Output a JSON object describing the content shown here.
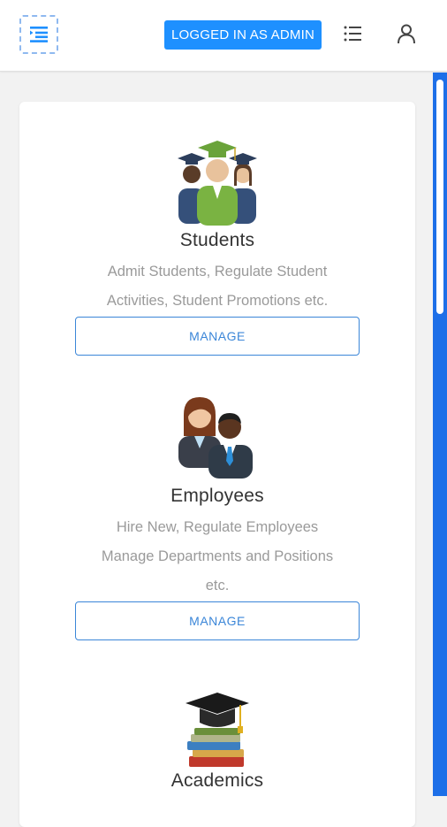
{
  "header": {
    "menu_icon": "sidebar-toggle-icon",
    "admin_badge": "LOGGED IN AS ADMIN",
    "list_icon": "list-icon",
    "user_icon": "user-icon"
  },
  "modules": [
    {
      "title": "Students",
      "description_lines": [
        "Admit Students, Regulate Student",
        "Activities, Student Promotions etc."
      ],
      "button": "MANAGE",
      "icon": "graduates-icon"
    },
    {
      "title": "Employees",
      "description_lines": [
        "Hire New, Regulate Employees",
        "Manage Departments and Positions",
        "etc."
      ],
      "button": "MANAGE",
      "icon": "employees-icon"
    },
    {
      "title": "Academics",
      "icon": "academics-icon"
    }
  ],
  "colors": {
    "accent": "#1e90ff",
    "button_border": "#3b86d8",
    "scrollbar": "#1d6fe8"
  }
}
